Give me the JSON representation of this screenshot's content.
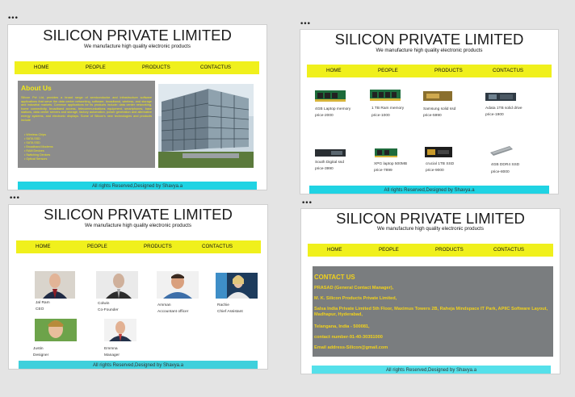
{
  "site": {
    "title": "SILICON PRIVATE LIMITED",
    "subtitle": "We manufacture high quality electronic products",
    "nav": [
      "HOME",
      "PEOPLE",
      "PRODUCTS",
      "CONTACTUS"
    ],
    "footer": "All rights Reserved,Designed by Shavya.a",
    "colors": {
      "navbar": "#f0f01c",
      "footer_bar": "#1fd3e3",
      "panel": "#8c8c8c",
      "accent_text": "#f0e818"
    }
  },
  "about": {
    "heading": "About Us",
    "text": "Silicon Pvt Ltd, provides a broad range of semiconductor and infrastructure software applications that serve the data center networking, software, broadband, wireless, and storage and industrial markets. Common applications for its products include: data center networking, home connectivity, broadband access, telecommunications equipment, smartphones, base stations, data center servers and storage, factory automation, power generation and alternative energy systems, and electronic displays. Some of Silicon's new technologies and products include",
    "list": [
      "Wireless Chips",
      "SATA SSD",
      "SATA SSD",
      "Broadband Modems",
      "RAM Devices",
      "Switching Devices",
      "Optical Sensors"
    ]
  },
  "products": [
    {
      "name": "4GB Laptop memory",
      "price": "price-2000",
      "icon": "ram-module-icon"
    },
    {
      "name": "1 TB Ram memory",
      "price": "price-1000",
      "icon": "ram-module-icon"
    },
    {
      "name": "Samsung solid ssd",
      "price": "price-5990",
      "icon": "ssd-icon"
    },
    {
      "name": "Adata 1TB solid drive",
      "price": "price-1900",
      "icon": "ssd-icon"
    },
    {
      "name": "South Digital ssd",
      "price": "price-3990",
      "icon": "ssd-icon"
    },
    {
      "name": "XPG laptop 500MB",
      "price": "price-7899",
      "icon": "ram-module-icon"
    },
    {
      "name": "crucial 1TB SSD",
      "price": "price-9000",
      "icon": "ssd-icon"
    },
    {
      "name": "4GB DDR4 SSD",
      "price": "price-8000",
      "icon": "ram-module-icon"
    }
  ],
  "people": [
    {
      "name": "Jal Ram",
      "role": "CEO"
    },
    {
      "name": "Colwin",
      "role": "Co-Founder"
    },
    {
      "name": "Amman",
      "role": "Accountant officer"
    },
    {
      "name": "Rachie",
      "role": "Chief Assistant"
    },
    {
      "name": "Justin",
      "role": "Designer"
    },
    {
      "name": "Emmna",
      "role": "Manager"
    }
  ],
  "contact": {
    "heading": "CONTACT US",
    "lines": [
      "PRASAD (General Contact Manager),",
      "M. K. Silicon Products Private Limited,",
      "Salsa India Private Limited 5th Floor, Maximus Towers 2B, Raheja Mindspace IT Park, APIIC Software Layout, Madhapur, Hyderabad,",
      "Telangana, India - 500081,",
      "contact number-91-40-30351000",
      "Email address-Silicon@gmail.com"
    ]
  }
}
